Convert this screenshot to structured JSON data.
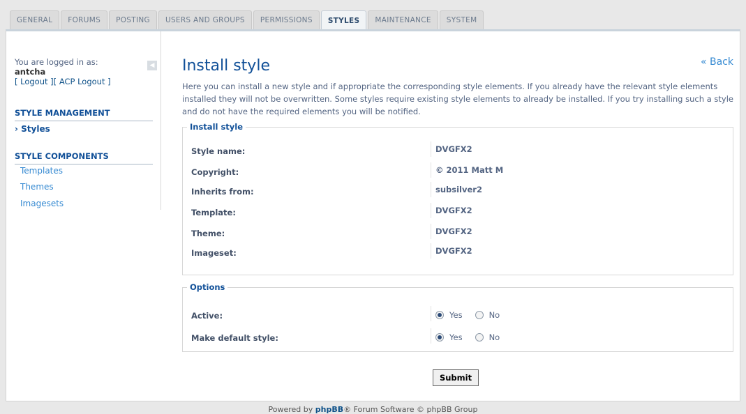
{
  "tabs": [
    {
      "label": "GENERAL",
      "active": false
    },
    {
      "label": "FORUMS",
      "active": false
    },
    {
      "label": "POSTING",
      "active": false
    },
    {
      "label": "USERS AND GROUPS",
      "active": false
    },
    {
      "label": "PERMISSIONS",
      "active": false
    },
    {
      "label": "STYLES",
      "active": true
    },
    {
      "label": "MAINTENANCE",
      "active": false
    },
    {
      "label": "SYSTEM",
      "active": false
    }
  ],
  "sidebar": {
    "logged_in_as": "You are logged in as:",
    "username": "antcha",
    "logout": "[ Logout ]",
    "acp_logout": "[ ACP Logout ]",
    "section1": "STYLE MANAGEMENT",
    "section1_items": [
      "Styles"
    ],
    "section2": "STYLE COMPONENTS",
    "section2_items": [
      "Templates",
      "Themes",
      "Imagesets"
    ]
  },
  "main": {
    "title": "Install style",
    "back": "« Back",
    "intro": "Here you can install a new style and if appropriate the corresponding style elements. If you already have the relevant style elements installed they will not be overwritten. Some styles require existing style elements to already be installed. If you try installing such a style and do not have the required elements you will be notified.",
    "install_legend": "Install style",
    "details": [
      {
        "label": "Style name:",
        "value": "DVGFX2"
      },
      {
        "label": "Copyright:",
        "value": "© 2011 Matt M"
      },
      {
        "label": "Inherits from:",
        "value": "subsilver2"
      },
      {
        "label": "Template:",
        "value": "DVGFX2"
      },
      {
        "label": "Theme:",
        "value": "DVGFX2"
      },
      {
        "label": "Imageset:",
        "value": "DVGFX2"
      }
    ],
    "options_legend": "Options",
    "options": [
      {
        "label": "Active:",
        "yes": "Yes",
        "no": "No",
        "selected": "yes"
      },
      {
        "label": "Make default style:",
        "yes": "Yes",
        "no": "No",
        "selected": "yes"
      }
    ],
    "submit": "Submit"
  },
  "footer": {
    "prefix": "Powered by",
    "phpbb": "phpBB",
    "suffix": "® Forum Software © phpBB Group"
  }
}
